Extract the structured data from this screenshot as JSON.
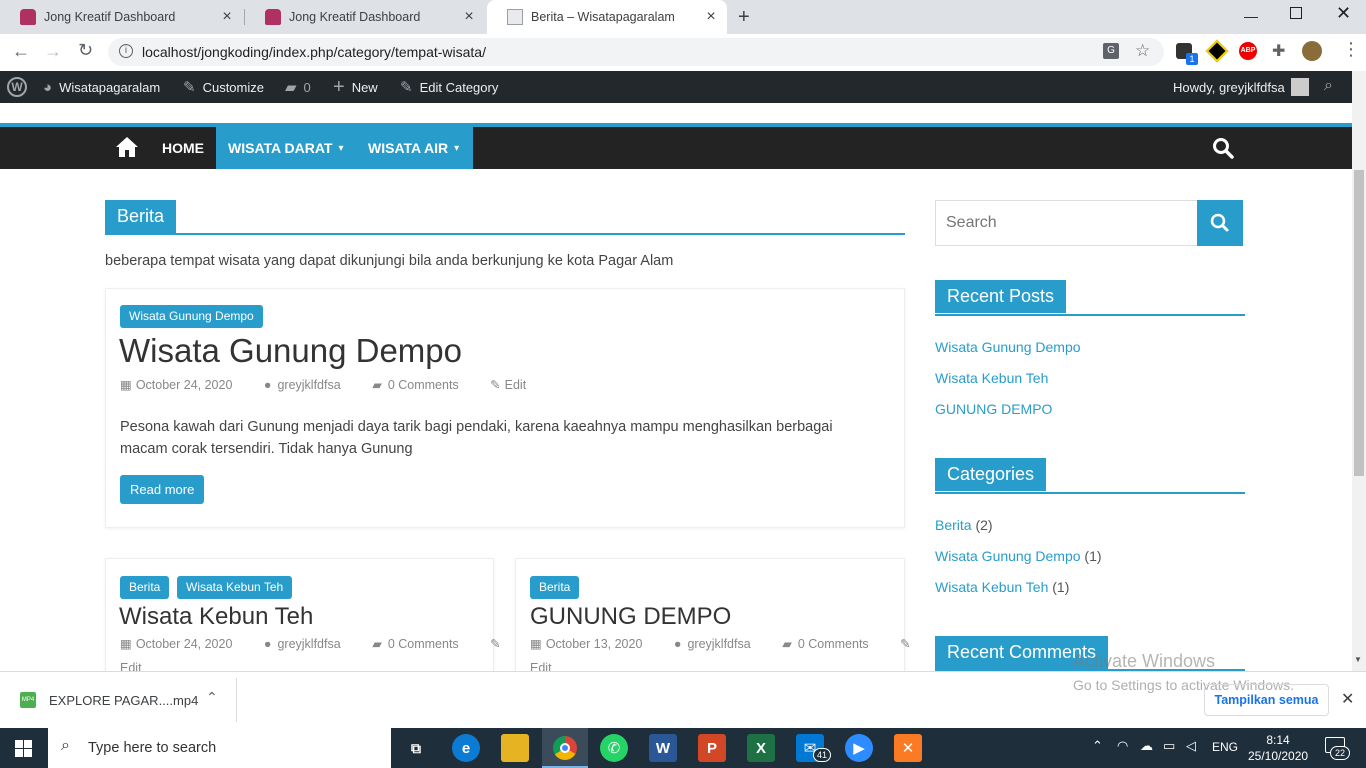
{
  "browser": {
    "tabs": [
      {
        "title": "Jong Kreatif Dashboard",
        "active": false
      },
      {
        "title": "Jong Kreatif Dashboard",
        "active": false
      },
      {
        "title": "Berita – Wisatapagaralam",
        "active": true
      }
    ],
    "url": "localhost/jongkoding/index.php/category/tempat-wisata/",
    "extension_badge": "1"
  },
  "adminbar": {
    "site_name": "Wisatapagaralam",
    "customize": "Customize",
    "comments_count": "0",
    "new_label": "New",
    "edit_category": "Edit Category",
    "howdy": "Howdy, greyjklfdfsa"
  },
  "nav": {
    "home": "HOME",
    "items": [
      {
        "label": "WISATA DARAT"
      },
      {
        "label": "WISATA AIR"
      }
    ]
  },
  "page": {
    "heading": "Berita",
    "description": "beberapa tempat wisata yang dapat dikunjungi bila anda berkunjung ke kota Pagar Alam"
  },
  "posts": [
    {
      "category": "Wisata Gunung Dempo",
      "title": "Wisata Gunung Dempo",
      "date": "October 24, 2020",
      "author": "greyjklfdfsa",
      "comments": "0 Comments",
      "edit": "Edit",
      "excerpt": "Pesona kawah dari Gunung menjadi daya tarik bagi pendaki, karena kaeahnya mampu menghasilkan berbagai macam corak tersendiri. Tidak hanya Gunung",
      "read_more": "Read more"
    },
    {
      "categories": [
        "Berita",
        "Wisata Kebun Teh"
      ],
      "title": "Wisata Kebun Teh",
      "date": "October 24, 2020",
      "author": "greyjklfdfsa",
      "comments": "0 Comments",
      "edit": "Edit"
    },
    {
      "categories": [
        "Berita"
      ],
      "title": "GUNUNG DEMPO",
      "date": "October 13, 2020",
      "author": "greyjklfdfsa",
      "comments": "0 Comments",
      "edit": "Edit"
    }
  ],
  "sidebar": {
    "search_placeholder": "Search",
    "recent_posts_title": "Recent Posts",
    "recent_posts": [
      "Wisata Gunung Dempo",
      "Wisata Kebun Teh",
      "GUNUNG DEMPO"
    ],
    "categories_title": "Categories",
    "categories": [
      {
        "name": "Berita",
        "count": "(2)"
      },
      {
        "name": "Wisata Gunung Dempo",
        "count": "(1)"
      },
      {
        "name": "Wisata Kebun Teh",
        "count": "(1)"
      }
    ],
    "recent_comments_title": "Recent Comments"
  },
  "watermark": {
    "line1": "Activate Windows",
    "line2": "Go to Settings to activate Windows."
  },
  "download": {
    "filename": "EXPLORE PAGAR....mp4",
    "show_all": "Tampilkan semua"
  },
  "taskbar": {
    "search_placeholder": "Type here to search",
    "lang": "ENG",
    "time": "8:14",
    "date": "25/10/2020",
    "mail_badge": "41",
    "notification_count": "22"
  },
  "colors": {
    "accent": "#289dcc",
    "adminbar": "#23282d",
    "nav": "#232323"
  }
}
